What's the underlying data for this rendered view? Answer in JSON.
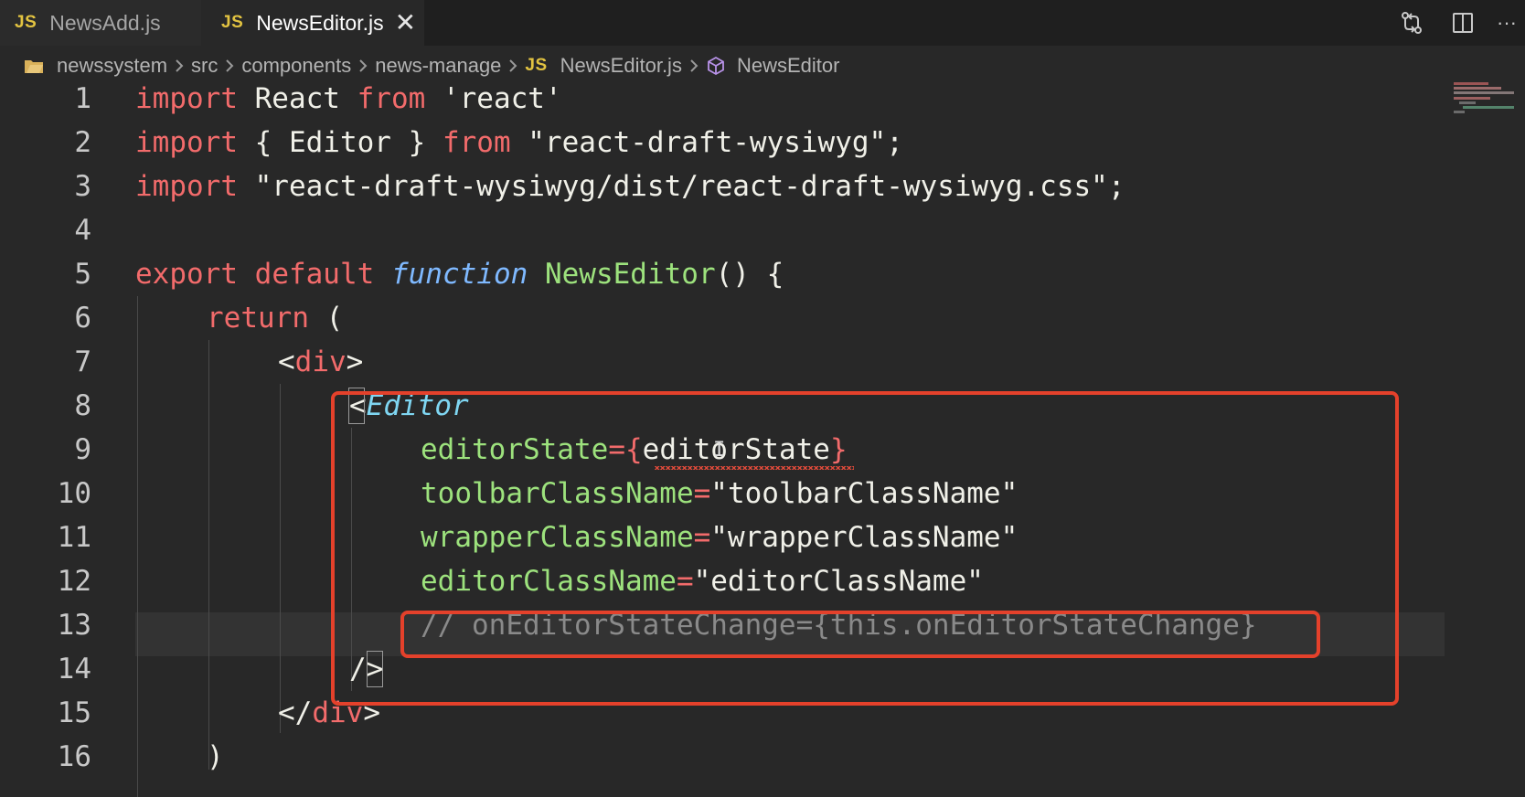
{
  "tabs": [
    {
      "badge": "JS",
      "label": "NewsAdd.js",
      "active": false
    },
    {
      "badge": "JS",
      "label": "NewsEditor.js",
      "active": true,
      "close": "✕"
    }
  ],
  "tab_actions": [
    {
      "icon": "compare-changes-icon"
    },
    {
      "icon": "split-editor-icon"
    },
    {
      "icon": "more-actions-icon",
      "label": "···"
    }
  ],
  "breadcrumb": {
    "items": [
      "newssystem",
      "src",
      "components",
      "news-manage"
    ],
    "file_badge": "JS",
    "file": "NewsEditor.js",
    "symbol": "NewsEditor"
  },
  "editor": {
    "line_numbers": [
      "1",
      "2",
      "3",
      "4",
      "5",
      "6",
      "7",
      "8",
      "9",
      "10",
      "11",
      "12",
      "13",
      "14",
      "15",
      "16"
    ],
    "lines": {
      "l1": [
        "import",
        " React ",
        "from",
        " 'react'"
      ],
      "l2": [
        "import",
        " { Editor } ",
        "from",
        " \"react-draft-wysiwyg\";"
      ],
      "l3": [
        "import",
        " \"react-draft-wysiwyg/dist/react-draft-wysiwyg.css\";"
      ],
      "l5": [
        "export",
        " ",
        "default",
        " ",
        "function",
        " ",
        "NewsEditor",
        "() {"
      ],
      "l6": [
        "return",
        " ("
      ],
      "l7": [
        "<",
        "div",
        ">"
      ],
      "l8": [
        "<",
        "Editor"
      ],
      "l9": [
        "editorState",
        "=",
        "{",
        "editorState",
        "}"
      ],
      "l10": [
        "toolbarClassName",
        "=",
        "\"toolbarClassName\""
      ],
      "l11": [
        "wrapperClassName",
        "=",
        "\"wrapperClassName\""
      ],
      "l12": [
        "editorClassName",
        "=",
        "\"editorClassName\""
      ],
      "l13": [
        "// onEditorStateChange={this.onEditorStateChange}"
      ],
      "l14": [
        "/",
        ">"
      ],
      "l15": [
        "</",
        "div",
        ">"
      ],
      "l16": [
        ")"
      ]
    }
  },
  "colors": {
    "keyword": "#f26b6b",
    "string": "#f0f0e8",
    "function_keyword": "#7fb9ff",
    "function_name": "#9de27d",
    "component": "#7fd6f2",
    "comment": "#8a8a8a",
    "highlight_box": "#e4412b",
    "js_badge": "#e2c341"
  }
}
